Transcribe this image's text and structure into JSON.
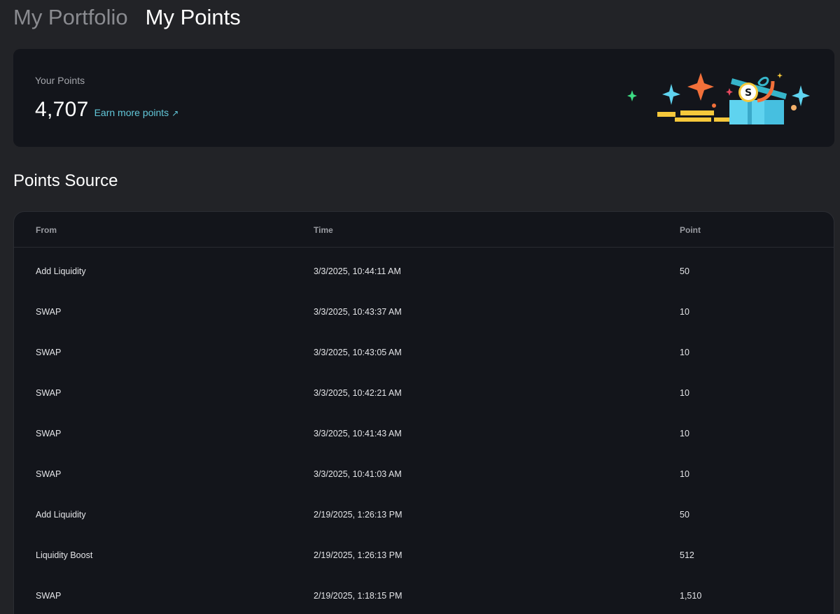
{
  "tabs": [
    {
      "label": "My Portfolio",
      "active": false
    },
    {
      "label": "My Points",
      "active": true
    }
  ],
  "points_card": {
    "label": "Your Points",
    "value": "4,707",
    "earn_link": "Earn more points",
    "earn_link_icon": "arrow-up-right-icon"
  },
  "section": {
    "title": "Points Source"
  },
  "table": {
    "headers": {
      "from": "From",
      "time": "Time",
      "point": "Point"
    },
    "rows": [
      {
        "from": "Add Liquidity",
        "time": "3/3/2025, 10:44:11 AM",
        "point": "50"
      },
      {
        "from": "SWAP",
        "time": "3/3/2025, 10:43:37 AM",
        "point": "10"
      },
      {
        "from": "SWAP",
        "time": "3/3/2025, 10:43:05 AM",
        "point": "10"
      },
      {
        "from": "SWAP",
        "time": "3/3/2025, 10:42:21 AM",
        "point": "10"
      },
      {
        "from": "SWAP",
        "time": "3/3/2025, 10:41:43 AM",
        "point": "10"
      },
      {
        "from": "SWAP",
        "time": "3/3/2025, 10:41:03 AM",
        "point": "10"
      },
      {
        "from": "Add Liquidity",
        "time": "2/19/2025, 1:26:13 PM",
        "point": "50"
      },
      {
        "from": "Liquidity Boost",
        "time": "2/19/2025, 1:26:13 PM",
        "point": "512"
      },
      {
        "from": "SWAP",
        "time": "2/19/2025, 1:18:15 PM",
        "point": "1,510"
      }
    ]
  },
  "colors": {
    "background": "#222327",
    "card": "#13151b",
    "accent_link": "#62c7d9",
    "sparkle_orange": "#f2703a",
    "sparkle_cyan": "#5fd3ef",
    "coin_yellow": "#f6c83b",
    "sparkle_green": "#3ddc84"
  }
}
